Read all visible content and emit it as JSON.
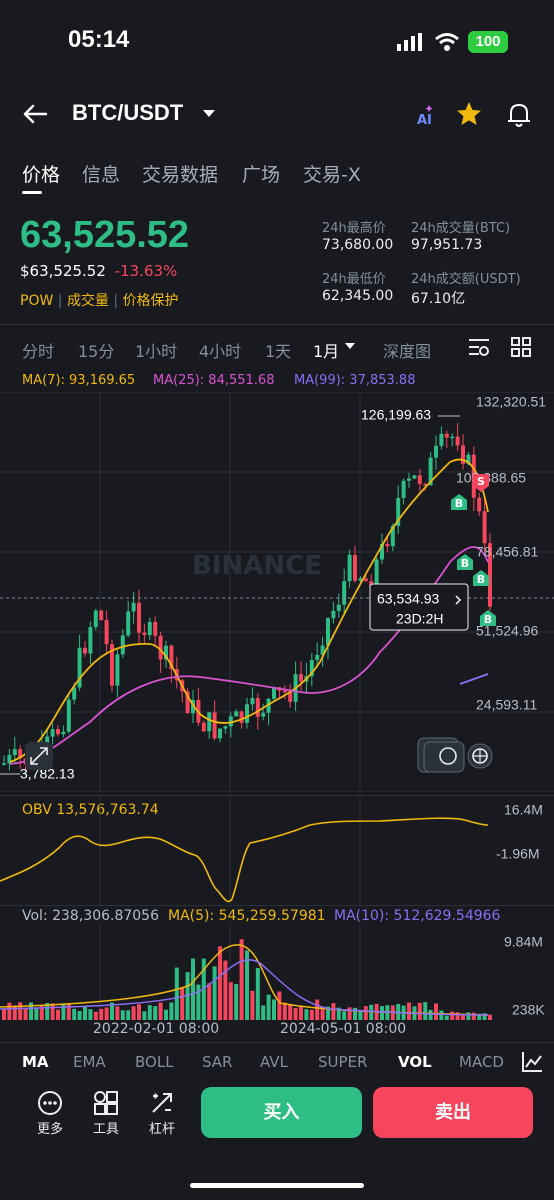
{
  "status": {
    "time": "05:14",
    "battery": "100"
  },
  "header": {
    "pair": "BTC/USDT"
  },
  "tabs": [
    "价格",
    "信息",
    "交易数据",
    "广场",
    "交易-X"
  ],
  "price": {
    "last": "63,525.52",
    "fiat": "$63,525.52",
    "change": "-13.63%",
    "tags": [
      "POW",
      "成交量",
      "价格保护"
    ]
  },
  "stats": {
    "high_label": "24h最高价",
    "high": "73,680.00",
    "vol_btc_label": "24h成交量(BTC)",
    "vol_btc": "97,951.73",
    "low_label": "24h最低价",
    "low": "62,345.00",
    "vol_usdt_label": "24h成交额(USDT)",
    "vol_usdt": "67.10亿"
  },
  "intervals": [
    "分时",
    "15分",
    "1小时",
    "4小时",
    "1天",
    "1月",
    "深度图"
  ],
  "active_interval": "1月",
  "ma": {
    "ma7": "MA(7): 93,169.65",
    "ma25": "MA(25): 84,551.68",
    "ma99": "MA(99): 37,853.88"
  },
  "axis": {
    "y": [
      "132,320.51",
      "105,388.65",
      "78,456.81",
      "51,524.96",
      "24,593.11"
    ],
    "high_label": "126,199.63",
    "low_label": "3,782.13",
    "current": "63,534.93",
    "countdown": "23D:2H",
    "watermark": "BINANCE"
  },
  "obv": {
    "label": "OBV 13,576,763.74",
    "y_top": "16.4M",
    "y_mid": "-1.96M"
  },
  "vol": {
    "label": "Vol: 238,306.87056",
    "ma5": "MA(5): 545,259.57981",
    "ma10": "MA(10): 512,629.54966",
    "y_top": "9.84M",
    "y_bottom": "238K",
    "x": [
      "2022-02-01 08:00",
      "2024-05-01 08:00"
    ]
  },
  "indicators": [
    "MA",
    "EMA",
    "BOLL",
    "SAR",
    "AVL",
    "SUPER",
    "VOL",
    "MACD"
  ],
  "bottom": {
    "more": "更多",
    "tools": "工具",
    "leverage": "杠杆",
    "buy": "买入",
    "sell": "卖出"
  },
  "colors": {
    "up": "#2ebd85",
    "down": "#f6465d",
    "accent": "#f0b90b",
    "ma7": "#f0b90b",
    "ma25": "#d954d1",
    "ma99": "#8c6ef4"
  }
}
